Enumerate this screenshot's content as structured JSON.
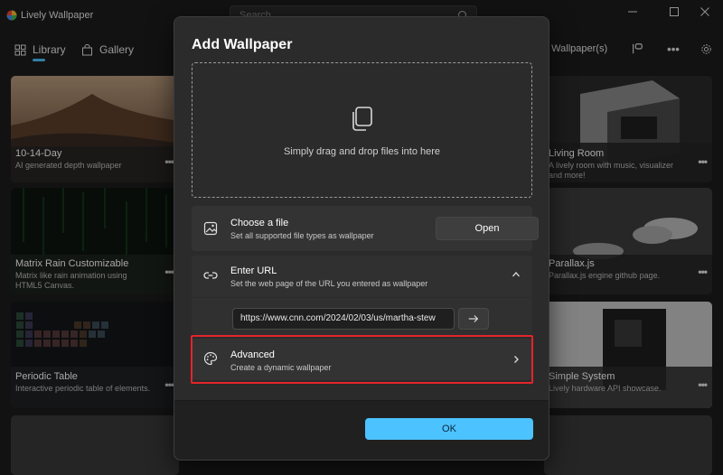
{
  "app": {
    "title": "Lively Wallpaper",
    "search_placeholder": "Search"
  },
  "nav": {
    "library_label": "Library",
    "gallery_label": "Gallery",
    "active_wallpaper_label": "tive Wallpaper(s)"
  },
  "cards": [
    {
      "title": "10-14-Day",
      "desc": "AI generated depth wallpaper",
      "more": "•••"
    },
    {
      "title": "Matrix Rain Customizable",
      "desc": "Matrix like rain animation using HTML5 Canvas.",
      "more": "•••"
    },
    {
      "title": "Periodic Table",
      "desc": "Interactive periodic table of elements.",
      "more": "•••"
    },
    {
      "title": "Living Room",
      "desc": "A lively room with music, visualizer and more!",
      "more": "•••"
    },
    {
      "title": "Parallax.js",
      "desc": "Parallax.js engine github page.",
      "more": "•••"
    },
    {
      "title": "Simple System",
      "desc": "Lively hardware API showcase.",
      "more": "•••"
    }
  ],
  "dialog": {
    "title": "Add Wallpaper",
    "drop_text": "Simply drag and drop files into here",
    "choose_file": {
      "title": "Choose a file",
      "subtitle": "Set all supported file types as wallpaper",
      "button": "Open"
    },
    "enter_url": {
      "title": "Enter URL",
      "subtitle": "Set the web page of the URL you entered as wallpaper",
      "value": "https://www.cnn.com/2024/02/03/us/martha-stew"
    },
    "advanced": {
      "title": "Advanced",
      "subtitle": "Create a dynamic wallpaper"
    },
    "ok_label": "OK"
  },
  "colors": {
    "accent": "#4cc2ff",
    "highlight_border": "#e3242b",
    "dialog_bg": "#2b2b2b"
  }
}
